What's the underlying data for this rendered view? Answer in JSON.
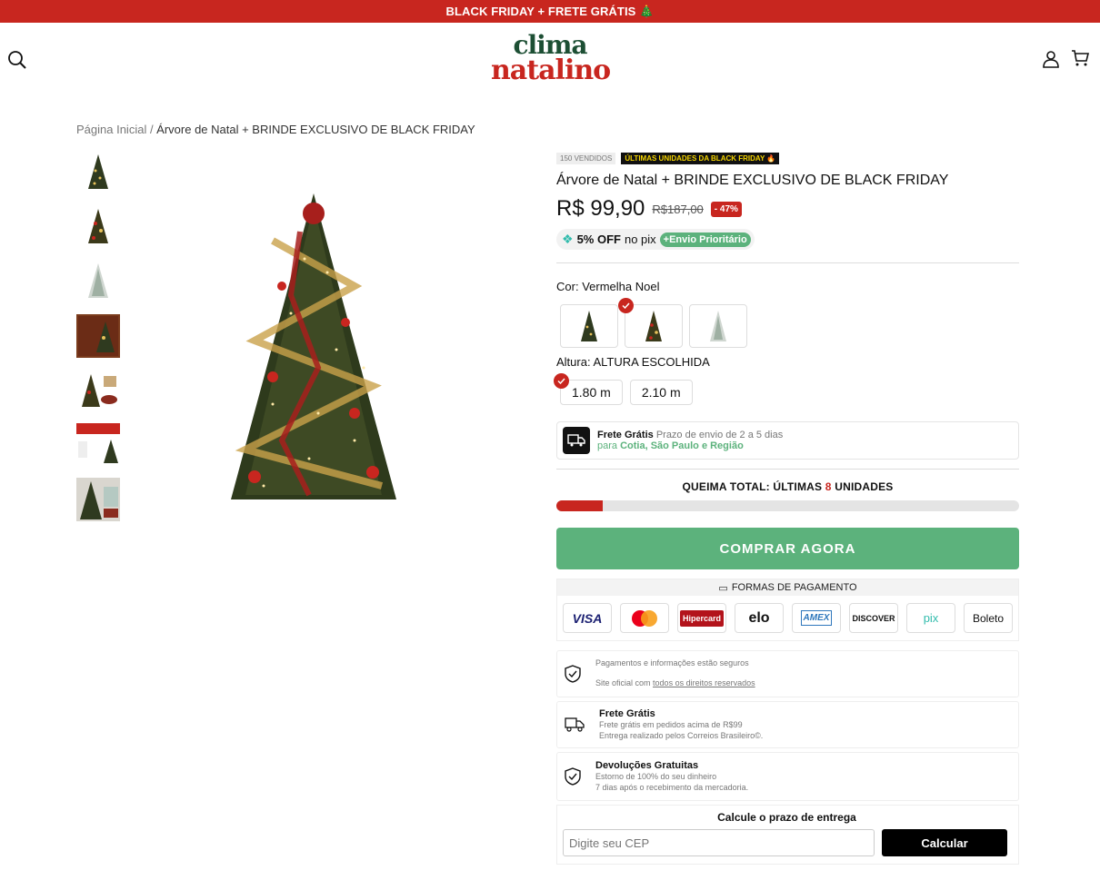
{
  "topbar": {
    "text": "BLACK FRIDAY + FRETE GRÁTIS 🎄"
  },
  "header": {
    "logo_line1": "clima",
    "logo_line2": "natalino"
  },
  "breadcrumb": {
    "home": "Página Inicial",
    "sep": " / ",
    "current": "Árvore de Natal + BRINDE EXCLUSIVO DE BLACK FRIDAY"
  },
  "product": {
    "sold": "150 VENDIDOS",
    "last_units": "ÚLTIMAS UNIDADES DA BLACK FRIDAY 🔥",
    "title": "Árvore de Natal + BRINDE EXCLUSIVO DE BLACK FRIDAY",
    "price": "R$ 99,90",
    "old_price": "R$187,00",
    "discount": "- 47%",
    "pix_off": "5% OFF",
    "pix_text": "no pix",
    "envio": "+Envio Prioritário"
  },
  "color": {
    "label": "Cor:",
    "selected": "Vermelha Noel"
  },
  "height": {
    "label": "Altura:",
    "selected": "ALTURA ESCOLHIDA",
    "options": [
      "1.80 m",
      "2.10 m"
    ]
  },
  "shipping": {
    "title": "Frete Grátis",
    "prazo": "Prazo de envio de 2 a 5 dias",
    "para": "para",
    "region": "Cotia, São Paulo e Região"
  },
  "queima": {
    "prefix": "QUEIMA TOTAL: ÚLTIMAS",
    "count": "8",
    "suffix": "UNIDADES",
    "progress": 0.1
  },
  "buy_label": "COMPRAR AGORA",
  "payment": {
    "header": "FORMAS DE PAGAMENTO",
    "cards": [
      "VISA",
      "Mastercard",
      "Hipercard",
      "elo",
      "AMEX",
      "DISCOVER",
      "pix",
      "Boleto"
    ]
  },
  "info": {
    "secure1": "Pagamentos e informações estão seguros",
    "secure2": "Site oficial com",
    "secure2_link": "todos os direitos reservados",
    "frete_title": "Frete Grátis",
    "frete_l1": "Frete grátis em pedidos acima de R$99",
    "frete_l2": "Entrega realizado pelos Correios Brasileiro©.",
    "dev_title": "Devoluções Gratuitas",
    "dev_l1": "Estorno de 100% do seu dinheiro",
    "dev_l2": "7 dias após o recebimento da mercadoria."
  },
  "cep": {
    "title": "Calcule o prazo de entrega",
    "placeholder": "Digite seu CEP",
    "button": "Calcular"
  },
  "colors": {
    "red": "#c8261f",
    "green": "#5cb27c",
    "dark_green": "#1d4f34"
  }
}
